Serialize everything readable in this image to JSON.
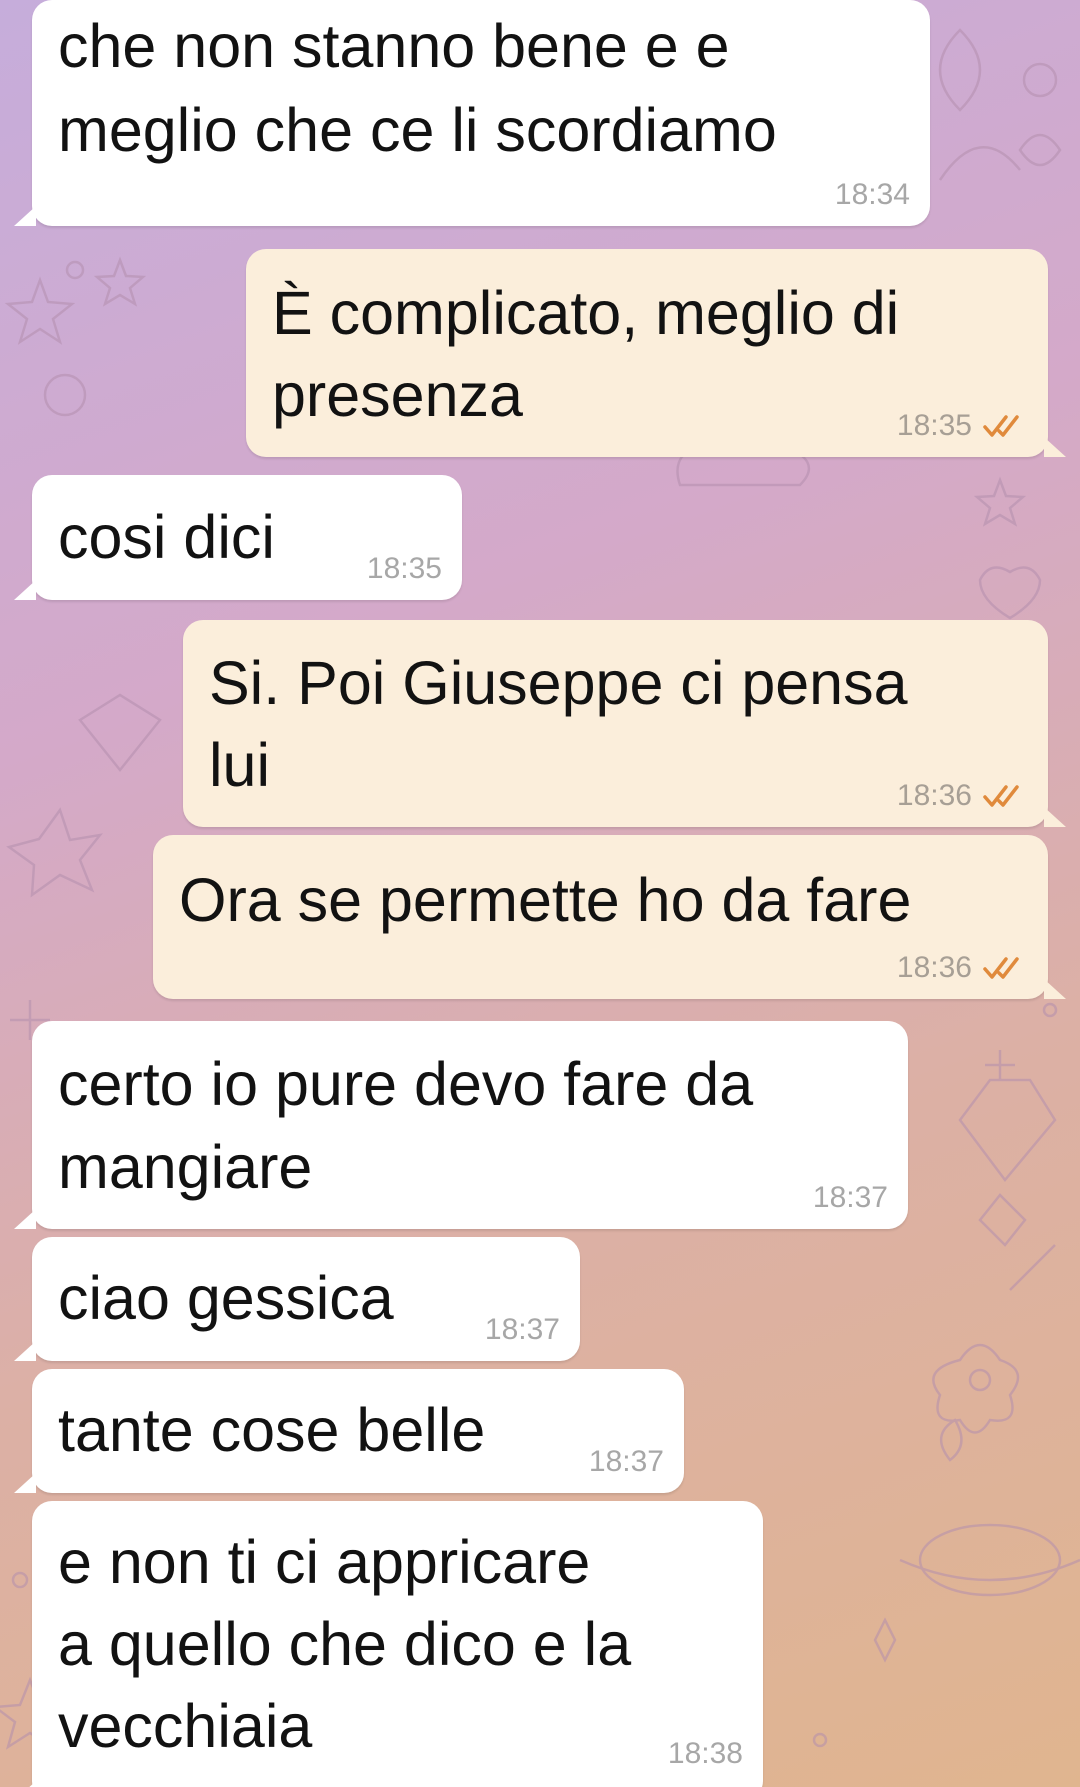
{
  "colors": {
    "incoming_bubble": "#ffffff",
    "outgoing_bubble": "#fbeedb",
    "timestamp": "#a7a7a7",
    "read_ticks": "#e08a3c"
  },
  "icons": {
    "read_receipt": "double-check-icon"
  },
  "messages": [
    {
      "direction": "incoming",
      "lines": [
        "che non stanno bene e e",
        "meglio che ce li scordiamo"
      ],
      "time": "18:34"
    },
    {
      "direction": "outgoing",
      "lines": [
        "È complicato, meglio di",
        "presenza"
      ],
      "time": "18:35",
      "read": true
    },
    {
      "direction": "incoming",
      "lines": [
        "cosi  dici"
      ],
      "time": "18:35"
    },
    {
      "direction": "outgoing",
      "lines": [
        "Si. Poi Giuseppe ci pensa",
        "lui"
      ],
      "time": "18:36",
      "read": true
    },
    {
      "direction": "outgoing",
      "lines": [
        "Ora se permette ho da fare"
      ],
      "time": "18:36",
      "read": true
    },
    {
      "direction": "incoming",
      "lines": [
        "certo io pure devo fare da",
        "mangiare"
      ],
      "time": "18:37"
    },
    {
      "direction": "incoming",
      "lines": [
        "ciao gessica"
      ],
      "time": "18:37"
    },
    {
      "direction": "incoming",
      "lines": [
        "tante cose belle"
      ],
      "time": "18:37"
    },
    {
      "direction": "incoming",
      "lines": [
        "e non ti ci appricare",
        "a quello che dico e la",
        "vecchiaia"
      ],
      "time": "18:38"
    }
  ]
}
